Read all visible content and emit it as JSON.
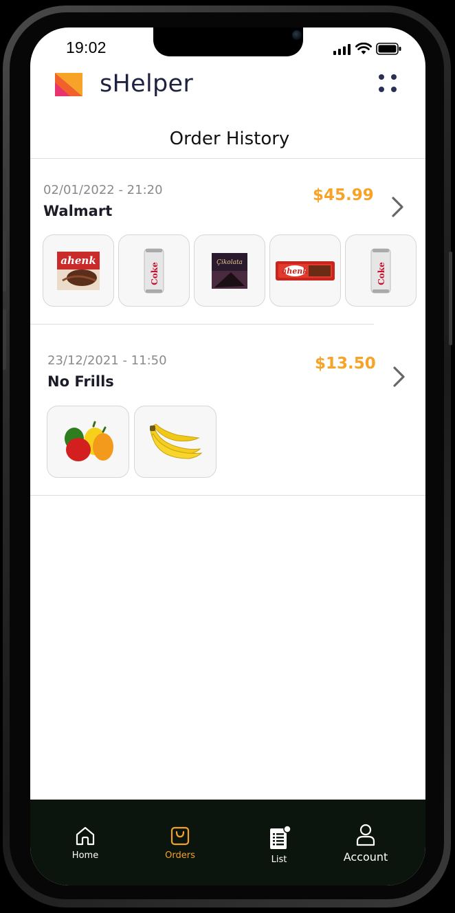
{
  "status_bar": {
    "time": "19:02"
  },
  "header": {
    "brand": "sHelper"
  },
  "page": {
    "title": "Order History"
  },
  "orders": [
    {
      "date": "02/01/2022 - 21:20",
      "store": "Walmart",
      "total": "$45.99",
      "items": [
        {
          "name": "ahenk chocolate cake",
          "text": "ahenk"
        },
        {
          "name": "diet coke can",
          "text": "Coke"
        },
        {
          "name": "dark chocolate bar",
          "text": "Çikolata"
        },
        {
          "name": "ahenk chocolate bar",
          "text": "ahenk"
        },
        {
          "name": "diet coke can",
          "text": "Coke"
        }
      ]
    },
    {
      "date": "23/12/2021 - 11:50",
      "store": "No Frills",
      "total": "$13.50",
      "items": [
        {
          "name": "bell peppers"
        },
        {
          "name": "bananas"
        }
      ]
    }
  ],
  "tabbar": {
    "items": [
      {
        "label": "Home",
        "icon": "home-icon"
      },
      {
        "label": "Orders",
        "icon": "shopping-bag-icon",
        "active": true
      },
      {
        "label": "List",
        "icon": "list-icon"
      },
      {
        "label": "Account",
        "icon": "user-icon"
      }
    ]
  },
  "colors": {
    "accent": "#f7a328",
    "brand_text": "#1e2140",
    "tabbar_bg": "#0b150d"
  }
}
